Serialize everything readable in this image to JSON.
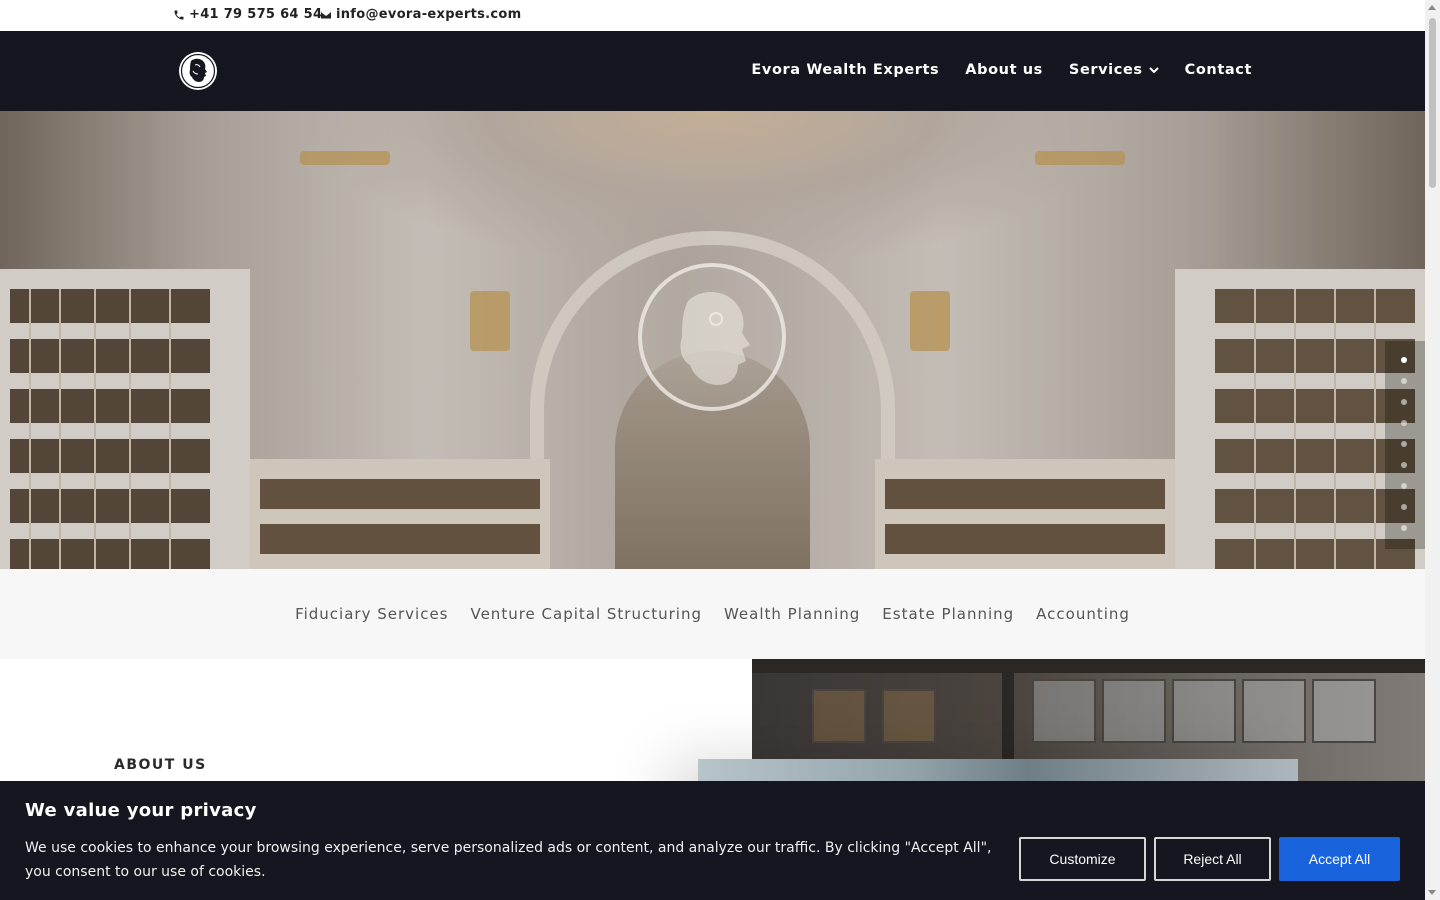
{
  "topbar": {
    "phone": "+41 79 575 64 54",
    "email": "info@evora-experts.com"
  },
  "nav": {
    "items": [
      {
        "label": "Evora Wealth Experts"
      },
      {
        "label": "About us"
      },
      {
        "label": "Services"
      },
      {
        "label": "Contact"
      }
    ]
  },
  "hero": {
    "slide_count": 9,
    "active_slide": 1
  },
  "services": [
    {
      "label": "Fiduciary Services"
    },
    {
      "label": "Venture Capital Structuring"
    },
    {
      "label": "Wealth Planning"
    },
    {
      "label": "Estate Planning"
    },
    {
      "label": "Accounting"
    }
  ],
  "about": {
    "label": "ABOUT US"
  },
  "cookie": {
    "title": "We value your privacy",
    "text": "We use cookies to enhance your browsing experience, serve personalized ads or content, and analyze our traffic. By clicking \"Accept All\", you consent to our use of cookies.",
    "customize_label": "Customize",
    "reject_label": "Reject All",
    "accept_label": "Accept All"
  },
  "colors": {
    "nav_bg": "#15161f",
    "accept_button": "#1863dc",
    "services_strip_bg": "#f7f7f7"
  }
}
